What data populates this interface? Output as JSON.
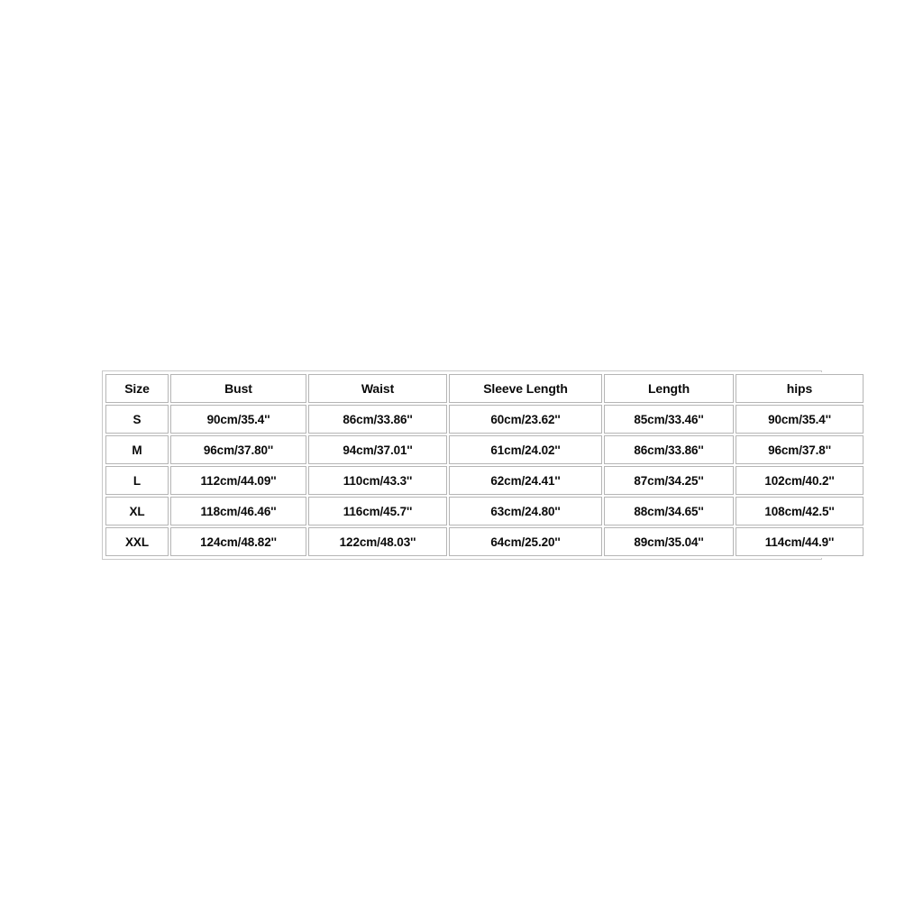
{
  "page": {
    "background_color": "#ffffff",
    "table_border_color": "#c9c9c9",
    "cell_border_color": "#b5b5b5",
    "text_color": "#0a0a0a"
  },
  "size_chart": {
    "headers": [
      "Size",
      "Bust",
      "Waist",
      "Sleeve Length",
      "Length",
      "hips"
    ],
    "rows": [
      {
        "size": "S",
        "bust": "90cm/35.4''",
        "waist": "86cm/33.86''",
        "sleeve_length": "60cm/23.62''",
        "length": "85cm/33.46''",
        "hips": "90cm/35.4''"
      },
      {
        "size": "M",
        "bust": "96cm/37.80''",
        "waist": "94cm/37.01''",
        "sleeve_length": "61cm/24.02''",
        "length": "86cm/33.86''",
        "hips": "96cm/37.8''"
      },
      {
        "size": "L",
        "bust": "112cm/44.09''",
        "waist": "110cm/43.3''",
        "sleeve_length": "62cm/24.41''",
        "length": "87cm/34.25''",
        "hips": "102cm/40.2''"
      },
      {
        "size": "XL",
        "bust": "118cm/46.46''",
        "waist": "116cm/45.7''",
        "sleeve_length": "63cm/24.80''",
        "length": "88cm/34.65''",
        "hips": "108cm/42.5''"
      },
      {
        "size": "XXL",
        "bust": "124cm/48.82''",
        "waist": "122cm/48.03''",
        "sleeve_length": "64cm/25.20''",
        "length": "89cm/35.04''",
        "hips": "114cm/44.9''"
      }
    ]
  }
}
